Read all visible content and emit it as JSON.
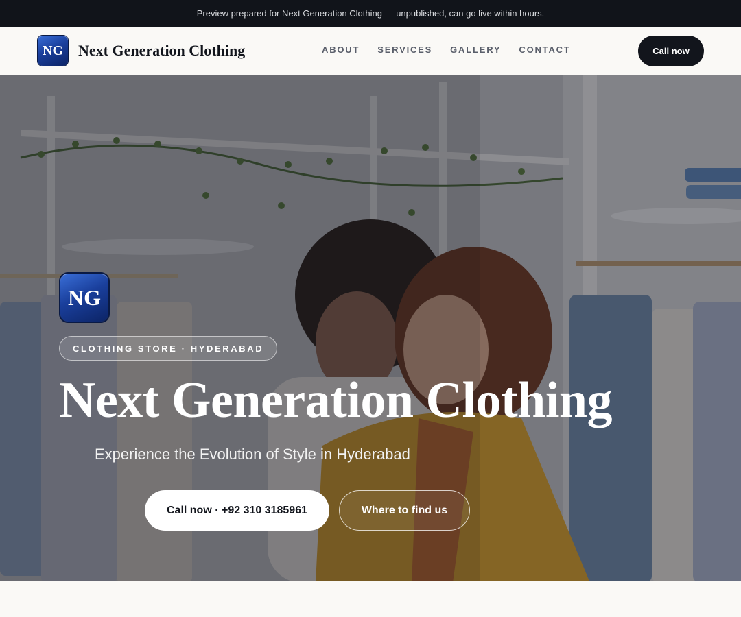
{
  "preview_banner": {
    "text": "Preview prepared for Next Generation Clothing — unpublished, can go live within hours."
  },
  "header": {
    "logo_initials": "NG",
    "brand_name": "Next Generation Clothing",
    "nav": [
      {
        "label": "ABOUT"
      },
      {
        "label": "SERVICES"
      },
      {
        "label": "GALLERY"
      },
      {
        "label": "CONTACT"
      }
    ],
    "cta_label": "Call now"
  },
  "hero": {
    "logo_initials": "NG",
    "eyebrow": "CLOTHING STORE · HYDERABAD",
    "title": "Next Generation Clothing",
    "subtitle": "Experience the Evolution of Style in Hyderabad",
    "primary_button": "Call now · +92 310 3185961",
    "secondary_button": "Where to find us"
  },
  "colors": {
    "banner_bg": "#11141a",
    "page_bg": "#faf9f6",
    "dark_button": "#12151c",
    "logo_blue": "#1a3f9c",
    "text_dark": "#12151c"
  }
}
